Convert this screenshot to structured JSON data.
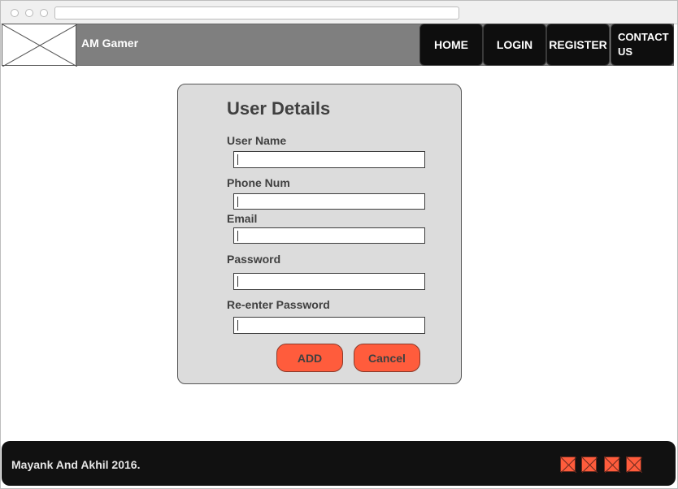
{
  "header": {
    "brand": "AM Gamer",
    "logo_icon": "image-placeholder-icon"
  },
  "nav": {
    "items": [
      {
        "label": "HOME"
      },
      {
        "label": "LOGIN"
      },
      {
        "label": "REGISTER"
      },
      {
        "label_line1": "CONTACT",
        "label_line2": "US"
      }
    ]
  },
  "form": {
    "title": "User Details",
    "fields": [
      {
        "label": "User Name",
        "value": ""
      },
      {
        "label": "Phone Num",
        "value": ""
      },
      {
        "label": "Email",
        "value": ""
      },
      {
        "label": "Password",
        "value": ""
      },
      {
        "label": "Re-enter Password",
        "value": ""
      }
    ],
    "add_label": "ADD",
    "cancel_label": "Cancel"
  },
  "footer": {
    "copyright": "Mayank And Akhil 2016.",
    "social_icons": [
      "social-icon",
      "social-icon",
      "social-icon",
      "social-icon"
    ]
  },
  "colors": {
    "accent": "#ff5c3c",
    "navbar": "#7f7f7f",
    "panel": "#dcdcdc",
    "dark": "#111111"
  }
}
